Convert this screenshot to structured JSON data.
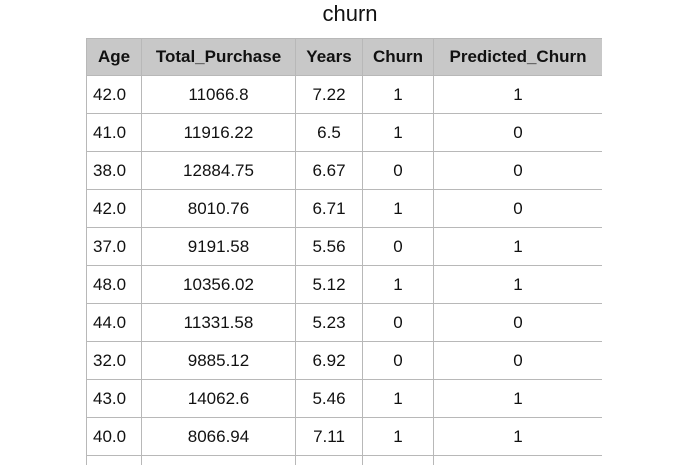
{
  "title": "churn",
  "table": {
    "headers": [
      "Age",
      "Total_Purchase",
      "Years",
      "Churn",
      "Predicted_Churn"
    ],
    "rows": [
      [
        "42.0",
        "11066.8",
        "7.22",
        "1",
        "1"
      ],
      [
        "41.0",
        "11916.22",
        "6.5",
        "1",
        "0"
      ],
      [
        "38.0",
        "12884.75",
        "6.67",
        "0",
        "0"
      ],
      [
        "42.0",
        "8010.76",
        "6.71",
        "1",
        "0"
      ],
      [
        "37.0",
        "9191.58",
        "5.56",
        "0",
        "1"
      ],
      [
        "48.0",
        "10356.02",
        "5.12",
        "1",
        "1"
      ],
      [
        "44.0",
        "11331.58",
        "5.23",
        "0",
        "0"
      ],
      [
        "32.0",
        "9885.12",
        "6.92",
        "0",
        "0"
      ],
      [
        "43.0",
        "14062.6",
        "5.46",
        "1",
        "1"
      ],
      [
        "40.0",
        "8066.94",
        "7.11",
        "1",
        "1"
      ]
    ]
  }
}
